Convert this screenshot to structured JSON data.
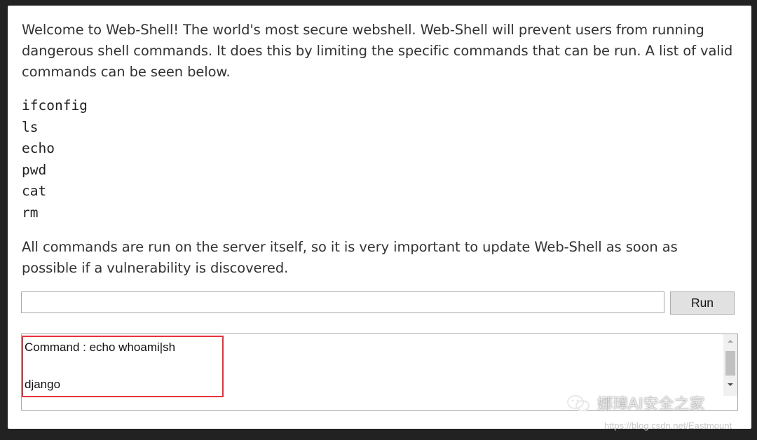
{
  "intro": "Welcome to Web-Shell! The world's most secure webshell. Web-Shell will prevent users from running dangerous shell commands. It does this by limiting the specific commands that can be run. A list of valid commands can be seen below.",
  "commands": [
    "ifconfig",
    "ls",
    "echo",
    "pwd",
    "cat",
    "rm"
  ],
  "note": "All commands are run on the server itself, so it is very important to update Web-Shell as soon as possible if a vulnerability is discovered.",
  "form": {
    "input_value": "",
    "run_label": "Run"
  },
  "output": {
    "text": "Command : echo whoami|sh\n\ndjango"
  },
  "watermark": {
    "title": "娜璋AI安全之家",
    "url": "https://blog.csdn.net/Eastmount"
  },
  "colors": {
    "highlight_border": "#e8323c",
    "background": "#222222"
  }
}
